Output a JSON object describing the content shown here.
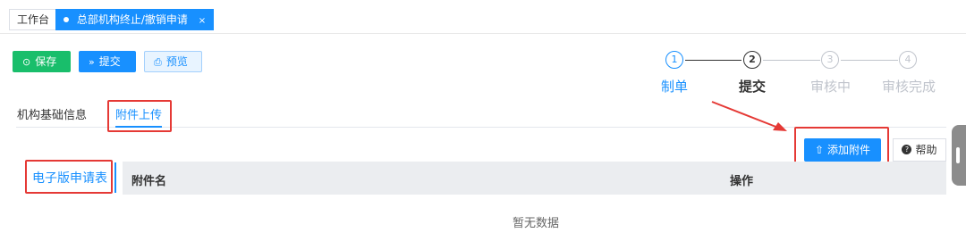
{
  "tabs": {
    "home_label": "工作台",
    "active_label": "总部机构终止/撤销申请",
    "close_glyph": "×"
  },
  "toolbar": {
    "save_label": "保存",
    "submit_label": "提交",
    "preview_label": "预览"
  },
  "steps": [
    {
      "number": "1",
      "label": "制单",
      "state": "done"
    },
    {
      "number": "2",
      "label": "提交",
      "state": "current"
    },
    {
      "number": "3",
      "label": "审核中",
      "state": "pending"
    },
    {
      "number": "4",
      "label": "审核完成",
      "state": "pending"
    }
  ],
  "subtabs": {
    "basic_info": "机构基础信息",
    "attachment_upload": "附件上传"
  },
  "attachments": {
    "add_label": "添加附件",
    "help_label": "帮助",
    "category": "电子版申请表",
    "columns": [
      "附件名",
      "操作"
    ],
    "empty_text": "暂无数据"
  },
  "colors": {
    "primary": "#1890ff",
    "success": "#19be6b",
    "annotation_red": "#e53935"
  }
}
